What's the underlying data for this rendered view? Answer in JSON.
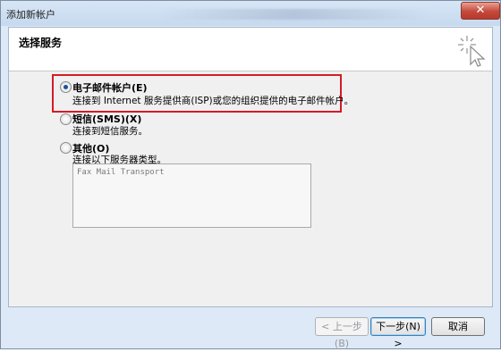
{
  "window": {
    "title": "添加新帐户"
  },
  "header": {
    "title": "选择服务"
  },
  "options": [
    {
      "label": "电子邮件帐户(E)",
      "description": "连接到 Internet 服务提供商(ISP)或您的组织提供的电子邮件帐户。",
      "selected": true
    },
    {
      "label": "短信(SMS)(X)",
      "description": "连接到短信服务。",
      "selected": false
    },
    {
      "label": "其他(O)",
      "description": "连接以下服务器类型。",
      "selected": false
    }
  ],
  "other_list": {
    "items": [
      "Fax Mail Transport"
    ]
  },
  "buttons": {
    "back": "< 上一步(B)",
    "next": "下一步(N) >",
    "cancel": "取消"
  },
  "colors": {
    "highlight": "#d61a27",
    "title_bar": "#c6d9ee"
  },
  "icons": {
    "close": "close-icon",
    "wizard": "wizard-cursor-icon"
  }
}
